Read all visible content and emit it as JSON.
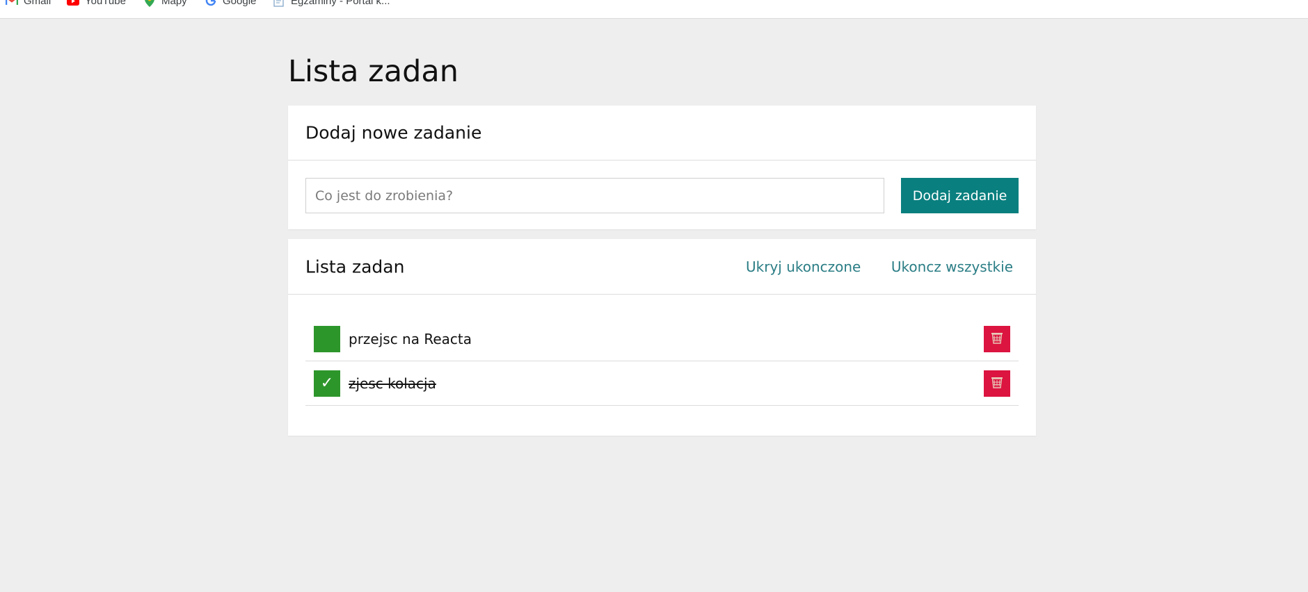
{
  "bookmarks": [
    {
      "label": "Gmail",
      "icon": "gmail-icon"
    },
    {
      "label": "YouTube",
      "icon": "youtube-icon"
    },
    {
      "label": "Mapy",
      "icon": "maps-icon"
    },
    {
      "label": "Google",
      "icon": "google-icon"
    },
    {
      "label": "Egzaminy - Portal k...",
      "icon": "document-icon"
    }
  ],
  "page": {
    "title": "Lista zadan"
  },
  "add_card": {
    "title": "Dodaj nowe zadanie",
    "input_placeholder": "Co jest do zrobienia?",
    "input_value": "",
    "button_label": "Dodaj zadanie"
  },
  "list_card": {
    "title": "Lista zadan",
    "hide_completed_label": "Ukryj ukonczone",
    "complete_all_label": "Ukoncz wszystkie",
    "tasks": [
      {
        "text": "przejsc na Reacta",
        "done": false,
        "check_glyph": ""
      },
      {
        "text": "zjesc kolacja",
        "done": true,
        "check_glyph": "✓"
      }
    ]
  },
  "colors": {
    "accent": "#0a7f7f",
    "link": "#2a7d85",
    "check": "#2d962b",
    "delete": "#dc1440",
    "background": "#eeeeee"
  }
}
